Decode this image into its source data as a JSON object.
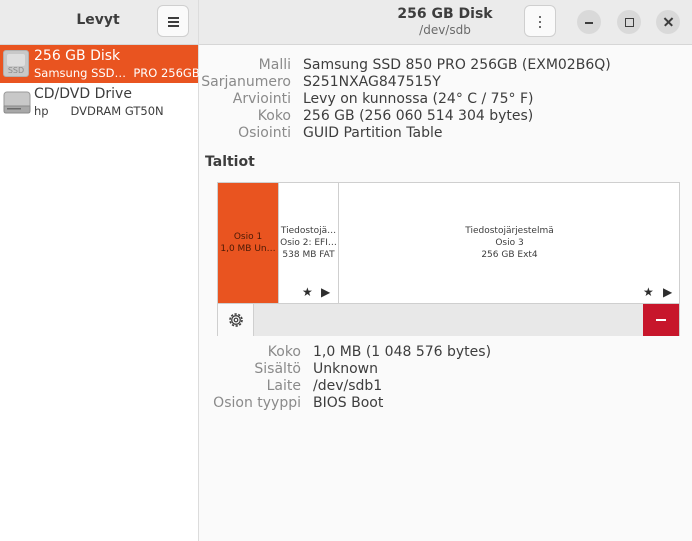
{
  "sidebar": {
    "title": "Levyt",
    "drives": [
      {
        "name": "256 GB Disk",
        "sub1": "Samsung SSD…",
        "sub2": "PRO 256GB",
        "icon": "ssd-icon",
        "badge": "SSD",
        "selected": true
      },
      {
        "name": "CD/DVD Drive",
        "sub1": "hp",
        "sub2": "DVDRAM GT50N",
        "icon": "optical-drive-icon",
        "selected": false
      }
    ]
  },
  "header": {
    "title": "256 GB Disk",
    "subtitle": "/dev/sdb"
  },
  "disk_info": [
    {
      "key": "Malli",
      "value": "Samsung SSD 850 PRO 256GB (EXM02B6Q)"
    },
    {
      "key": "Sarjanumero",
      "value": "S251NXAG847515Y"
    },
    {
      "key": "Arviointi",
      "value": "Levy on kunnossa (24° C / 75° F)"
    },
    {
      "key": "Koko",
      "value": "256 GB (256 060 514 304 bytes)"
    },
    {
      "key": "Osiointi",
      "value": "GUID Partition Table"
    }
  ],
  "volumes_title": "Taltiot",
  "volumes": [
    {
      "lines": [
        "Osio 1",
        "1,0 MB Un…"
      ],
      "selected": true
    },
    {
      "lines": [
        "Tiedostojä…",
        "Osio 2: EFI…",
        "538 MB FAT"
      ],
      "selected": false,
      "icons": [
        "★",
        "▶"
      ]
    },
    {
      "lines": [
        "Tiedostojärjestelmä",
        "Osio 3",
        "256 GB Ext4"
      ],
      "selected": false,
      "icons": [
        "★",
        "▶"
      ]
    }
  ],
  "partition_details": [
    {
      "key": "Koko",
      "value": "1,0 MB (1 048 576 bytes)"
    },
    {
      "key": "Sisältö",
      "value": "Unknown"
    },
    {
      "key": "Laite",
      "value": "/dev/sdb1"
    },
    {
      "key": "Osion tyyppi",
      "value": "BIOS Boot"
    }
  ],
  "colors": {
    "accent": "#e95420",
    "danger": "#c7162b"
  }
}
